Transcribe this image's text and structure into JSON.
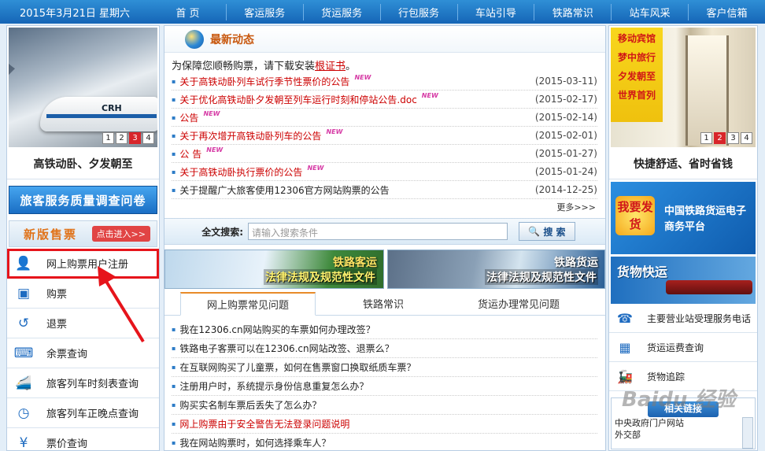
{
  "topnav": {
    "date": "2015年3月21日 星期六",
    "items": [
      "首 页",
      "客运服务",
      "货运服务",
      "行包服务",
      "车站引导",
      "铁路常识",
      "站车风采",
      "客户信箱"
    ]
  },
  "left": {
    "slide_caption": "高铁动卧、夕发朝至",
    "slide_logo": "CRH",
    "pager": [
      "1",
      "2",
      "3",
      "4"
    ],
    "pager_active": "3",
    "survey": "旅客服务质量调查问卷",
    "newver_title": "新版售票",
    "newver_btn": "点击进入>>",
    "menu": [
      "网上购票用户注册",
      "购票",
      "退票",
      "余票查询",
      "旅客列车时刻表查询",
      "旅客列车正晚点查询",
      "票价查询"
    ]
  },
  "mid": {
    "news_title": "最新动态",
    "notice_prefix": "为保障您顺畅购票，请下载安装",
    "notice_link": "根证书",
    "notice_suffix": "。",
    "new_badge": "NEW",
    "news": [
      {
        "t": "关于高铁动卧列车试行季节性票价的公告",
        "d": "(2015-03-11)"
      },
      {
        "t": "关于优化高铁动卧夕发朝至列车运行时刻和停站公告.doc",
        "d": "(2015-02-17)"
      },
      {
        "t": "公告",
        "d": "(2015-02-14)"
      },
      {
        "t": "关于再次增开高铁动卧列车的公告",
        "d": "(2015-02-01)"
      },
      {
        "t": "公 告",
        "d": "(2015-01-27)"
      },
      {
        "t": "关于高铁动卧执行票价的公告",
        "d": "(2015-01-24)"
      },
      {
        "t": "关于提醒广大旅客使用12306官方网站购票的公告",
        "d": "(2014-12-25)"
      }
    ],
    "more": "更多>>>",
    "search_label": "全文搜索:",
    "search_placeholder": "请输入搜索条件",
    "search_btn": "搜 索",
    "banner1_title": "铁路客运",
    "banner1_sub": "法律法规及规范性文件",
    "banner2_title": "铁路货运",
    "banner2_sub": "法律法规及规范性文件",
    "tabs": [
      "网上购票常见问题",
      "铁路常识",
      "货运办理常见问题"
    ],
    "faq": [
      "我在12306.cn网站购买的车票如何办理改签？",
      "铁路电子客票可以在12306.cn网站改签、退票么？",
      "在互联网购买了儿童票，如何在售票窗口换取纸质车票？",
      "注册用户时，系统提示身份信息重复怎么办？",
      "购买实名制车票后丢失了怎么办？",
      "网上购票由于安全警告无法登录问题说明",
      "我在网站购票时，如何选择乘车人？"
    ]
  },
  "right": {
    "slide_sign": [
      "移动宾馆",
      "梦中旅行",
      "夕发朝至",
      "世界首列"
    ],
    "pager": [
      "1",
      "2",
      "3",
      "4"
    ],
    "pager_active": "2",
    "slide_caption": "快捷舒适、省时省钱",
    "ad1_badge": "我要发货",
    "ad1_text": "中国铁路货运电子商务平台",
    "ad2_text": "货物快运",
    "menu": [
      "主要营业站受理服务电话",
      "货运运费查询",
      "货物追踪"
    ],
    "friend_title": "相关链接",
    "friend_links": [
      "中央政府门户网站",
      "外交部"
    ]
  },
  "watermark": "Baidu 经验"
}
